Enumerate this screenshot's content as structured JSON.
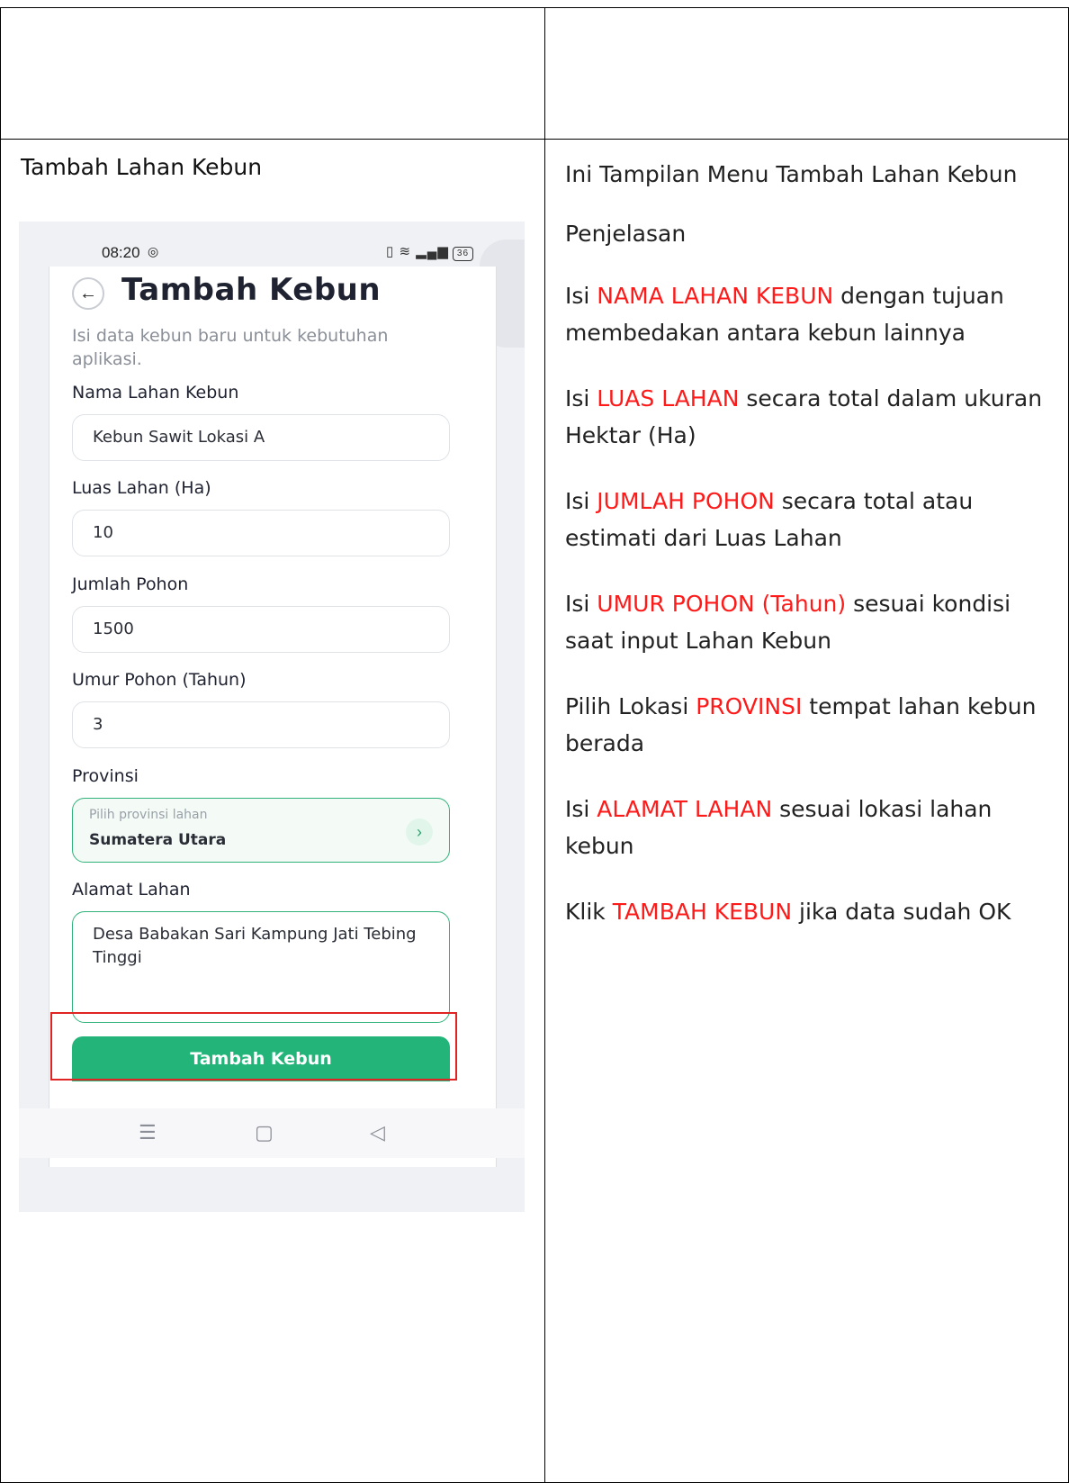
{
  "left_cell": {
    "title": "Tambah Lahan Kebun"
  },
  "phone": {
    "status": {
      "time": "08:20",
      "battery": "36"
    },
    "header": {
      "title": "Tambah Kebun",
      "subtitle": "Isi data kebun baru untuk kebutuhan aplikasi."
    },
    "fields": {
      "nama": {
        "label": "Nama Lahan Kebun",
        "value": "Kebun Sawit Lokasi A"
      },
      "luas": {
        "label": "Luas Lahan (Ha)",
        "value": "10"
      },
      "jumlah": {
        "label": "Jumlah Pohon",
        "value": "1500"
      },
      "umur": {
        "label": "Umur Pohon (Tahun)",
        "value": "3"
      },
      "provinsi": {
        "label": "Provinsi",
        "hint": "Pilih provinsi lahan",
        "value": "Sumatera Utara"
      },
      "alamat": {
        "label": "Alamat Lahan",
        "value": "Desa Babakan Sari Kampung Jati Tebing Tinggi"
      }
    },
    "submit_label": "Tambah Kebun",
    "accent_color": "#23b47a",
    "highlight_box_color": "#e02424"
  },
  "right_cell": {
    "heading": "Ini Tampilan Menu Tambah Lahan Kebun",
    "sub": "Penjelasan",
    "items": [
      {
        "pre": "Isi ",
        "hl": "NAMA LAHAN KEBUN",
        "post": " dengan tujuan membedakan antara kebun lainnya"
      },
      {
        "pre": "Isi ",
        "hl": "LUAS LAHAN",
        "post": " secara total dalam ukuran Hektar (Ha)"
      },
      {
        "pre": "Isi ",
        "hl": "JUMLAH POHON",
        "post": " secara total atau estimati dari Luas Lahan"
      },
      {
        "pre": "Isi ",
        "hl": "UMUR POHON (Tahun)",
        "post": " sesuai kondisi saat input Lahan Kebun"
      },
      {
        "pre": "Pilih Lokasi ",
        "hl": "PROVINSI",
        "post": " tempat lahan kebun berada"
      },
      {
        "pre": "Isi ",
        "hl": "ALAMAT LAHAN",
        "post": " sesuai lokasi lahan kebun"
      },
      {
        "pre": "Klik ",
        "hl": "TAMBAH KEBUN",
        "post": " jika data sudah OK"
      }
    ],
    "highlight_color": "#ff1a1a"
  }
}
